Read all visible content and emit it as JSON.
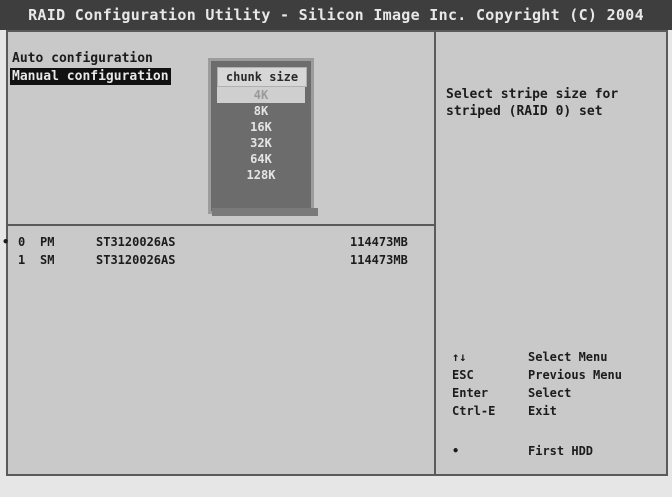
{
  "title": "RAID Configuration Utility - Silicon Image Inc. Copyright (C) 2004",
  "menu": {
    "items": [
      "Auto configuration",
      "Manual configuration"
    ],
    "selected_index": 1
  },
  "chunk_popup": {
    "title": "chunk size",
    "options": [
      "4K",
      "8K",
      "16K",
      "32K",
      "64K",
      "128K"
    ],
    "selected": "4K"
  },
  "drives": [
    {
      "marker": "•",
      "num": "0",
      "role": "PM",
      "model": "ST3120026AS",
      "size": "114473MB"
    },
    {
      "marker": "",
      "num": "1",
      "role": "SM",
      "model": "ST3120026AS",
      "size": "114473MB"
    }
  ],
  "help": {
    "text": "Select stripe size for striped (RAID 0) set"
  },
  "keys": [
    {
      "key": "↑↓",
      "desc": "Select Menu"
    },
    {
      "key": "ESC",
      "desc": "Previous Menu"
    },
    {
      "key": "Enter",
      "desc": "Select"
    },
    {
      "key": "Ctrl-E",
      "desc": "Exit"
    },
    {
      "key": "•",
      "desc": "First HDD"
    }
  ],
  "colors": {
    "background": "#e6e6e6",
    "panel": "#c9c9c9",
    "title_bar": "#3e3e3e",
    "highlight_bg": "#111111",
    "popup_bg": "#6c6c6c"
  }
}
